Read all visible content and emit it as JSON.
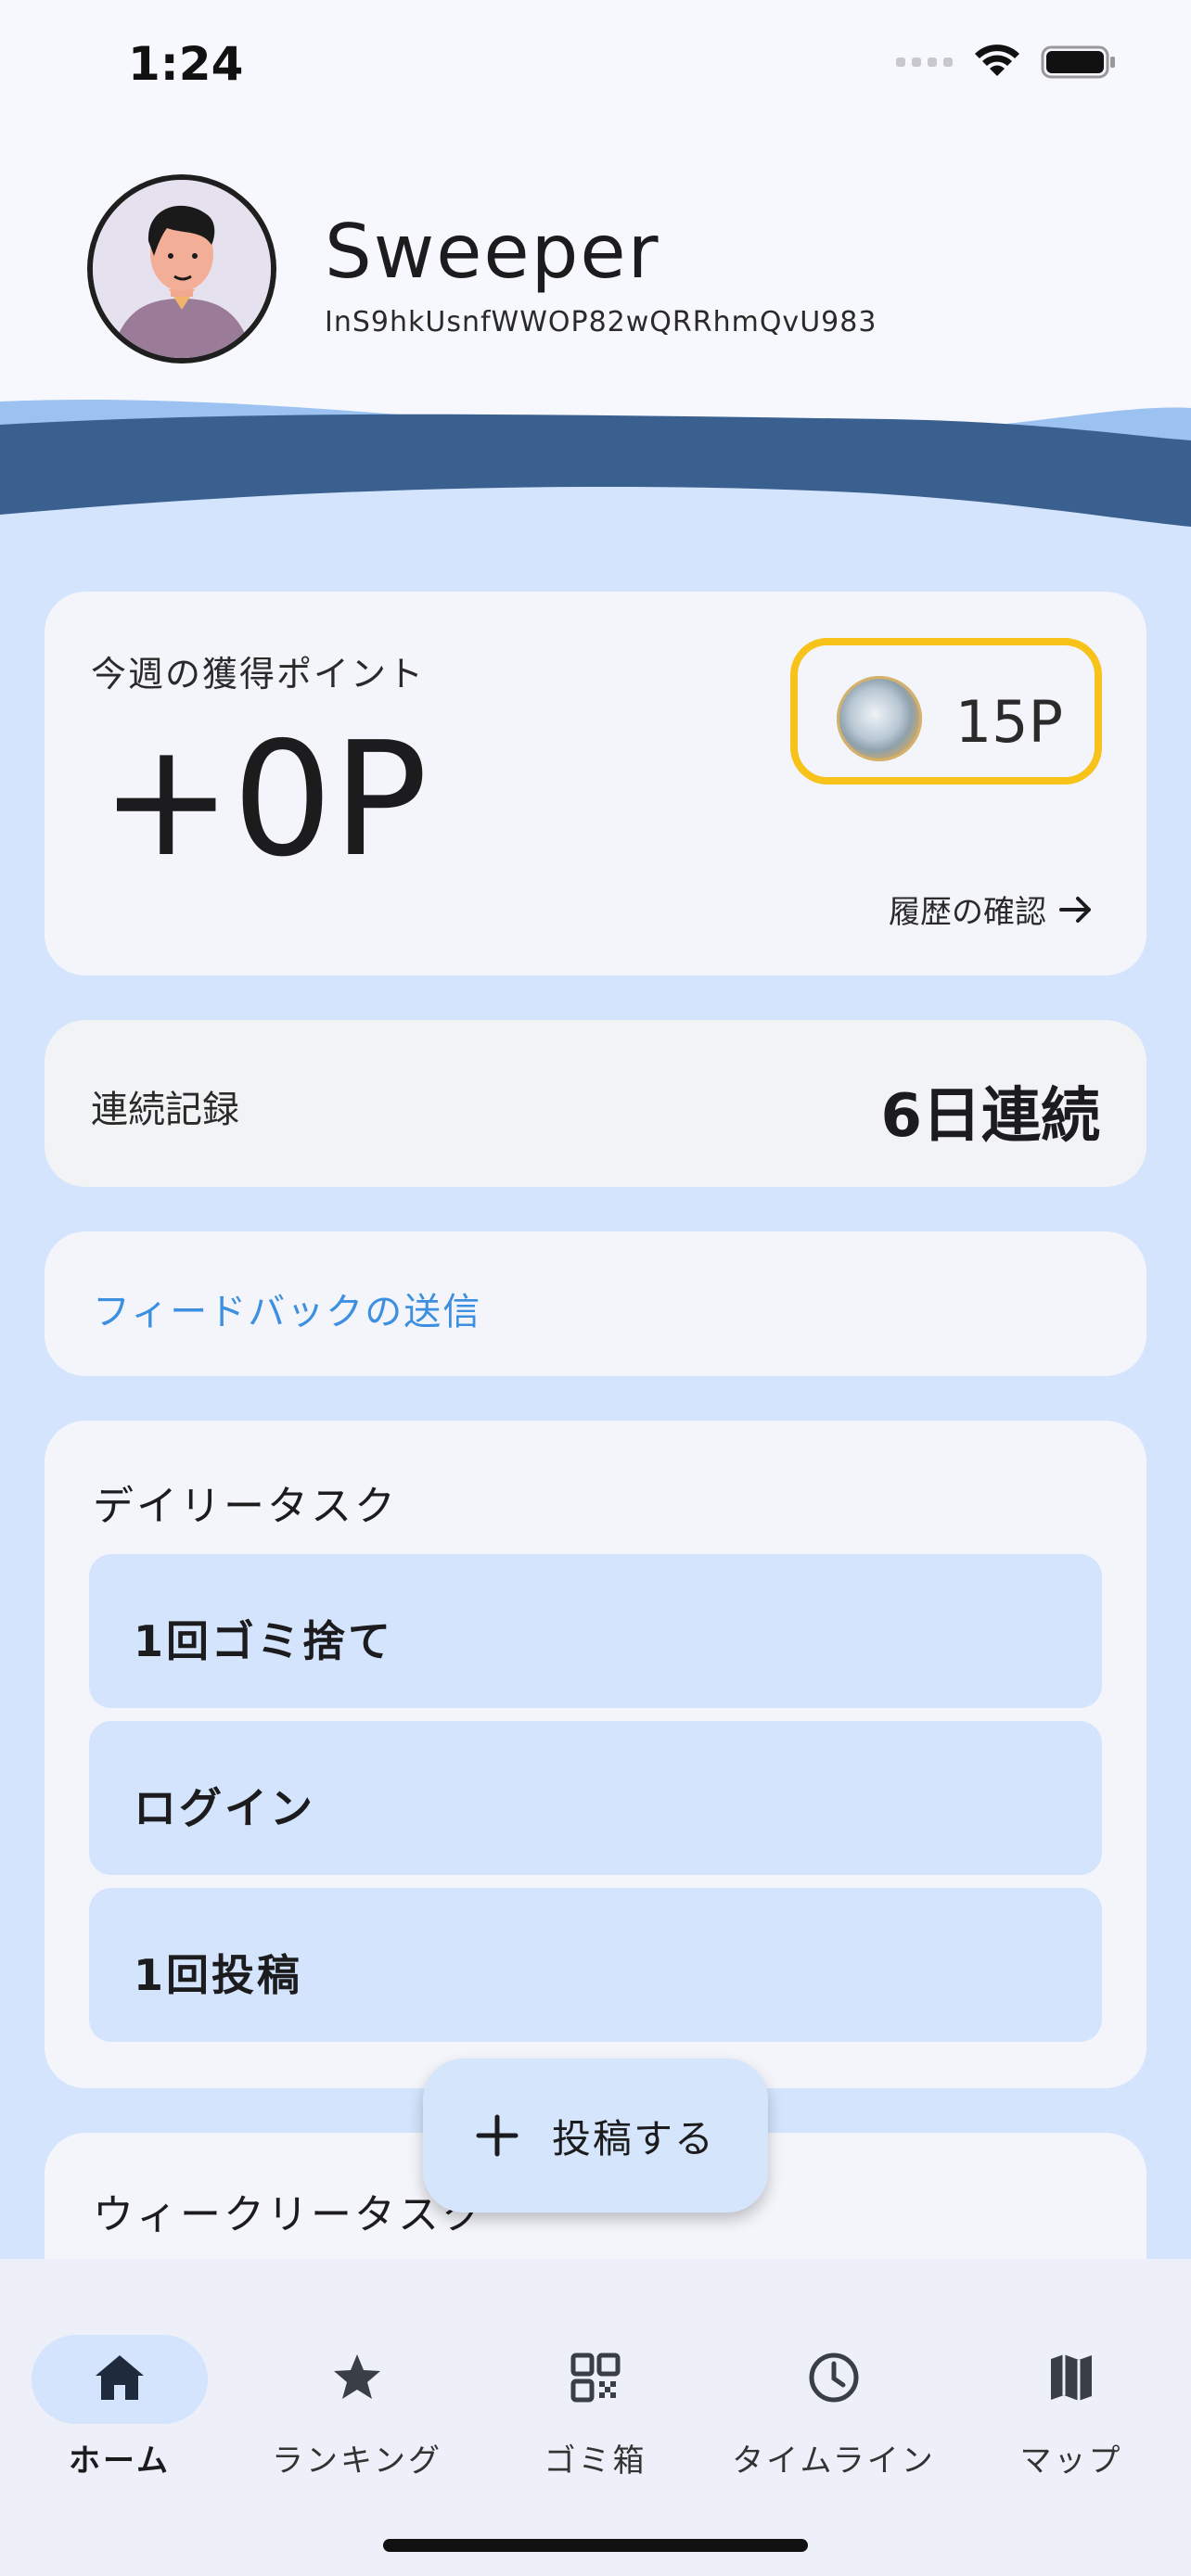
{
  "status_bar": {
    "time": "1:24"
  },
  "profile": {
    "name": "Sweeper",
    "id": "InS9hkUsnfWWOP82wQRRhmQvU983"
  },
  "points_card": {
    "week_label": "今週の獲得ポイント",
    "week_value": "+0P",
    "balance": "15P",
    "history_link": "履歴の確認",
    "coin_border_color": "#f7c31a"
  },
  "streak": {
    "label": "連続記録",
    "value": "6日連続"
  },
  "feedback": {
    "label": "フィードバックの送信",
    "color": "#3d8fe0"
  },
  "daily_tasks": {
    "title": "デイリータスク",
    "items": [
      "1回ゴミ捨て",
      "ログイン",
      "1回投稿"
    ]
  },
  "weekly_tasks": {
    "title": "ウィークリータスク"
  },
  "fab": {
    "label": "投稿する"
  },
  "nav": {
    "items": [
      {
        "label": "ホーム",
        "icon": "home-icon",
        "active": true
      },
      {
        "label": "ランキング",
        "icon": "star-icon",
        "active": false
      },
      {
        "label": "ゴミ箱",
        "icon": "qr-code-icon",
        "active": false
      },
      {
        "label": "タイムライン",
        "icon": "clock-icon",
        "active": false
      },
      {
        "label": "マップ",
        "icon": "map-icon",
        "active": false
      }
    ]
  }
}
